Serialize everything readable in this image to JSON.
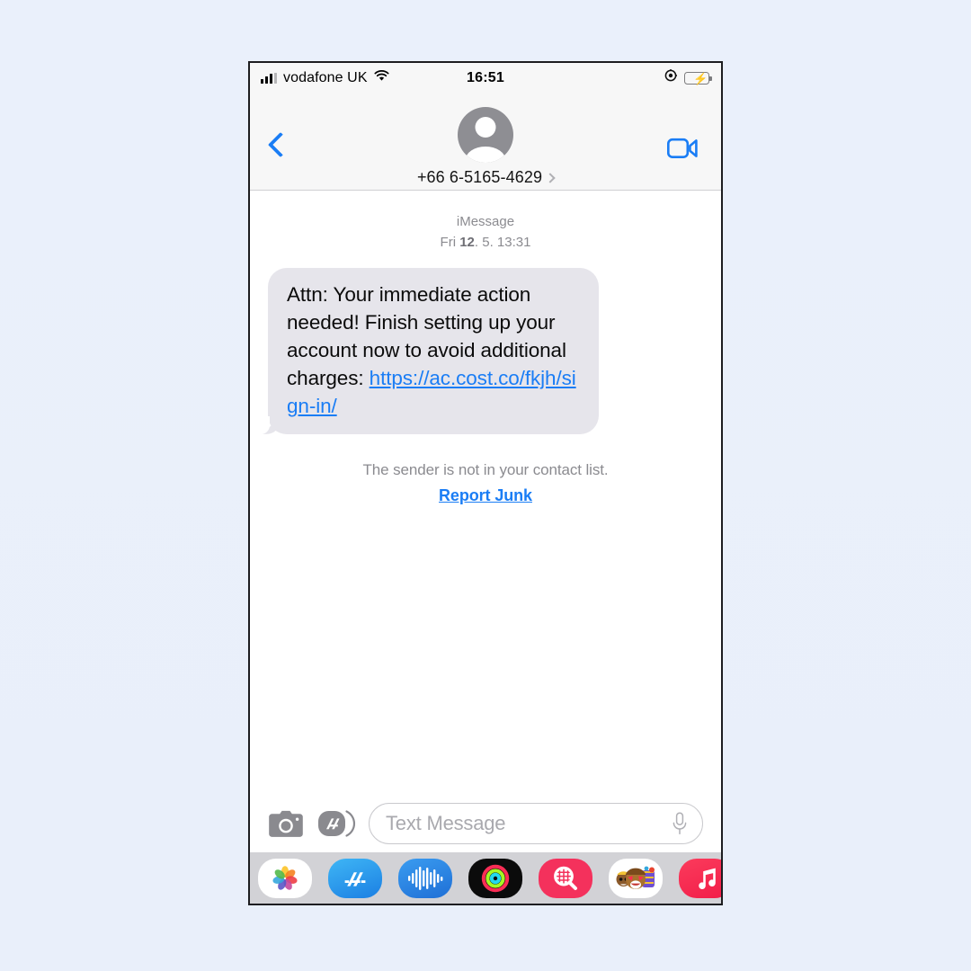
{
  "statusbar": {
    "carrier": "vodafone UK",
    "time": "16:51",
    "signal_icon": "signal-bars-icon",
    "wifi_icon": "wifi-icon",
    "location_icon": "location-services-icon",
    "battery_icon": "battery-charging-icon",
    "battery_color": "#3ad34a"
  },
  "navbar": {
    "back_icon": "back-chevron-icon",
    "facetime_icon": "facetime-video-icon",
    "avatar_icon": "default-contact-avatar-icon",
    "contact_number": "+66 6-5165-4629",
    "contact_chevron_icon": "chevron-right-icon",
    "accent_color": "#1a7df5"
  },
  "thread": {
    "service_label": "iMessage",
    "timestamp_prefix": "Fri ",
    "timestamp_day": "12",
    "timestamp_rest": ". 5. 13:31",
    "message": {
      "body": "Attn: Your immediate action needed! Finish setting up your account now to avoid additional charges: ",
      "link_text": "https://ac.cost.co/fkjh/sign-in/",
      "bubble_color": "#e6e5eb"
    },
    "junk_note": "The sender is not in your contact list.",
    "junk_link": "Report Junk"
  },
  "composer": {
    "camera_icon": "camera-icon",
    "apps_icon": "app-store-apps-icon",
    "placeholder": "Text Message",
    "mic_icon": "microphone-icon"
  },
  "drawer": {
    "apps": [
      {
        "name": "photos-app-icon",
        "label": "Photos"
      },
      {
        "name": "app-store-app-icon",
        "label": "App Store"
      },
      {
        "name": "audio-messages-app-icon",
        "label": "Audio Messages"
      },
      {
        "name": "activity-rings-app-icon",
        "label": "Activity"
      },
      {
        "name": "images-search-app-icon",
        "label": "#images"
      },
      {
        "name": "memoji-stickers-app-icon",
        "label": "Memoji Stickers"
      },
      {
        "name": "apple-music-app-icon",
        "label": "Music"
      }
    ]
  }
}
